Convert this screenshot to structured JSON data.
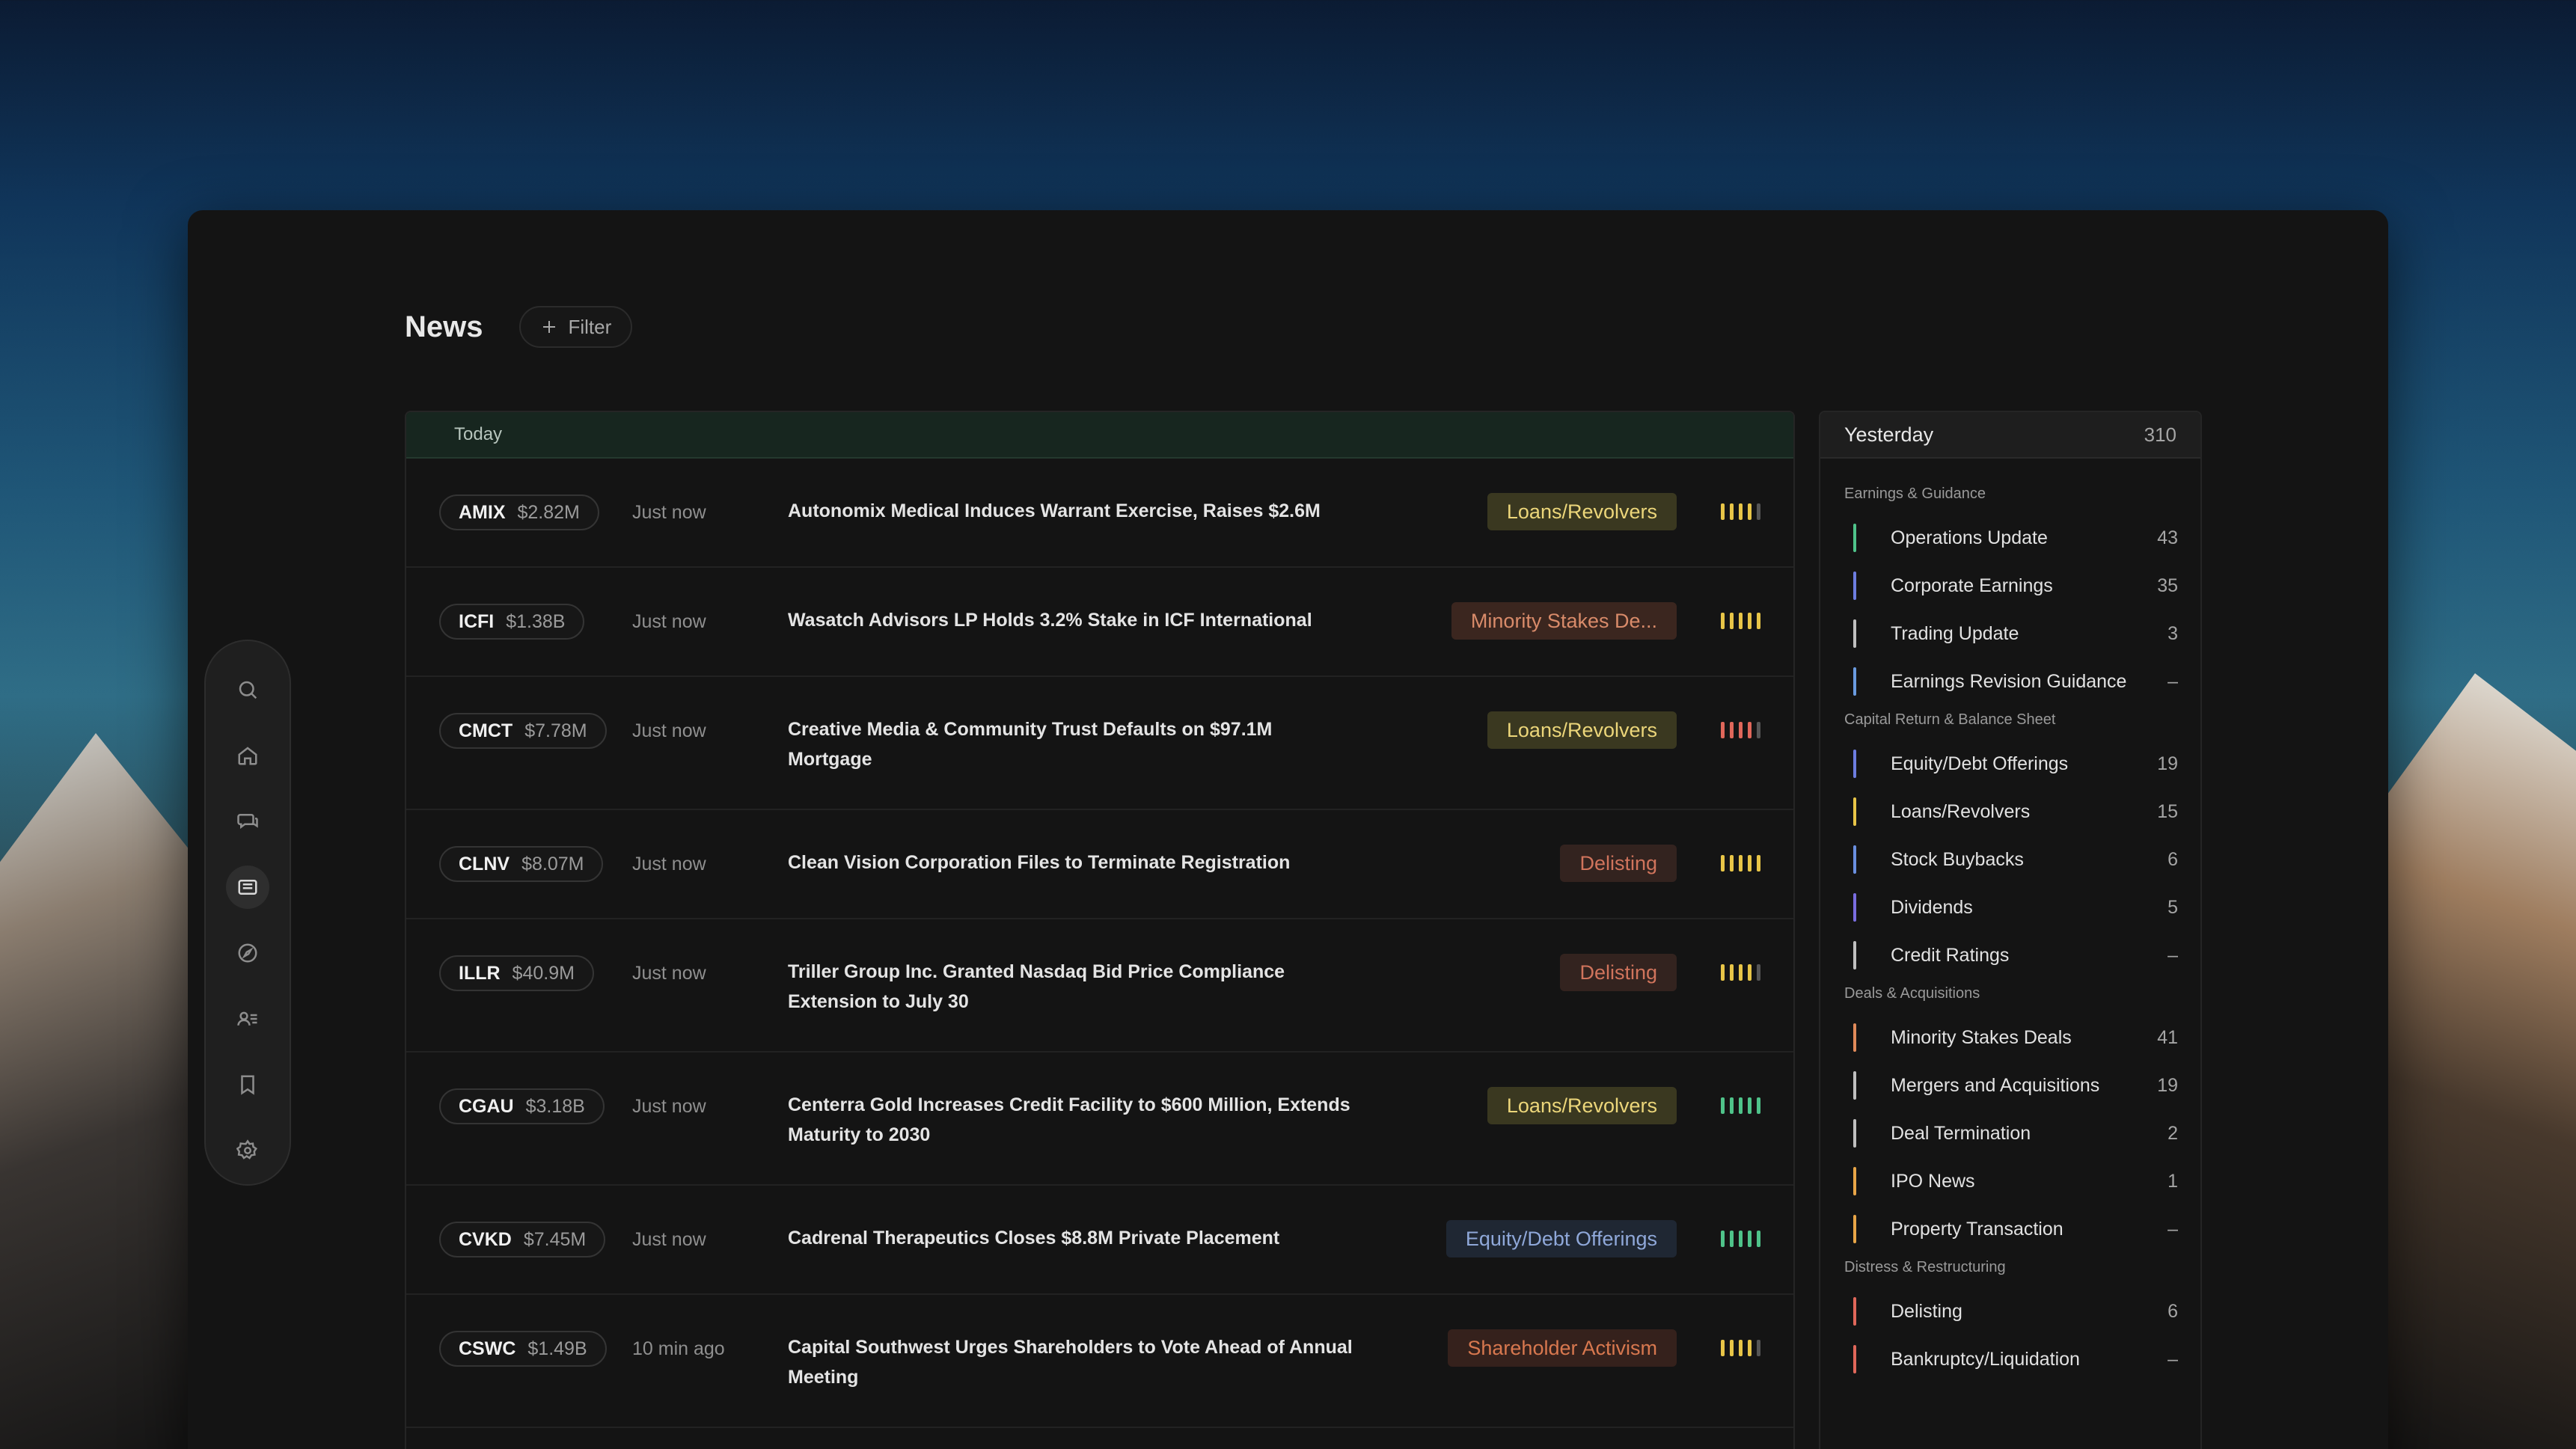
{
  "header": {
    "title": "News",
    "filter_label": "Filter"
  },
  "news_panel": {
    "group_label": "Today",
    "rows": [
      {
        "ticker": "AMIX",
        "mcap": "$2.82M",
        "time": "Just now",
        "headline": "Autonomix Medical Induces Warrant Exercise, Raises $2.6M",
        "tag": "Loans/Revolvers"
      },
      {
        "ticker": "ICFI",
        "mcap": "$1.38B",
        "time": "Just now",
        "headline": "Wasatch Advisors LP Holds 3.2% Stake in ICF International",
        "tag": "Minority Stakes De..."
      },
      {
        "ticker": "CMCT",
        "mcap": "$7.78M",
        "time": "Just now",
        "headline": "Creative Media & Community Trust Defaults on $97.1M Mortgage",
        "tag": "Loans/Revolvers"
      },
      {
        "ticker": "CLNV",
        "mcap": "$8.07M",
        "time": "Just now",
        "headline": "Clean Vision Corporation Files to Terminate Registration",
        "tag": "Delisting"
      },
      {
        "ticker": "ILLR",
        "mcap": "$40.9M",
        "time": "Just now",
        "headline": "Triller Group Inc. Granted Nasdaq Bid Price Compliance Extension to July 30",
        "tag": "Delisting"
      },
      {
        "ticker": "CGAU",
        "mcap": "$3.18B",
        "time": "Just now",
        "headline": "Centerra Gold Increases Credit Facility to $600 Million, Extends Maturity to 2030",
        "tag": "Loans/Revolvers"
      },
      {
        "ticker": "CVKD",
        "mcap": "$7.45M",
        "time": "Just now",
        "headline": "Cadrenal Therapeutics Closes $8.8M Private Placement",
        "tag": "Equity/Debt Offerings"
      },
      {
        "ticker": "CSWC",
        "mcap": "$1.49B",
        "time": "10 min ago",
        "headline": "Capital Southwest Urges Shareholders to Vote Ahead of Annual Meeting",
        "tag": "Shareholder Activism"
      }
    ]
  },
  "side_panel": {
    "title": "Yesterday",
    "count": "310",
    "sections": [
      {
        "label": "Earnings & Guidance",
        "items": [
          {
            "label": "Operations Update",
            "count": "43"
          },
          {
            "label": "Corporate Earnings",
            "count": "35"
          },
          {
            "label": "Trading Update",
            "count": "3"
          },
          {
            "label": "Earnings Revision Guidance",
            "count": "–"
          }
        ]
      },
      {
        "label": "Capital Return & Balance Sheet",
        "items": [
          {
            "label": "Equity/Debt Offerings",
            "count": "19"
          },
          {
            "label": "Loans/Revolvers",
            "count": "15"
          },
          {
            "label": "Stock Buybacks",
            "count": "6"
          },
          {
            "label": "Dividends",
            "count": "5"
          },
          {
            "label": "Credit Ratings",
            "count": "–"
          }
        ]
      },
      {
        "label": "Deals & Acquisitions",
        "items": [
          {
            "label": "Minority Stakes Deals",
            "count": "41"
          },
          {
            "label": "Mergers and Acquisitions",
            "count": "19"
          },
          {
            "label": "Deal Termination",
            "count": "2"
          },
          {
            "label": "IPO News",
            "count": "1"
          },
          {
            "label": "Property Transaction",
            "count": "–"
          }
        ]
      },
      {
        "label": "Distress & Restructuring",
        "items": [
          {
            "label": "Delisting",
            "count": "6"
          },
          {
            "label": "Bankruptcy/Liquidation",
            "count": "–"
          }
        ]
      }
    ]
  },
  "sidebar_icons": [
    "search-icon",
    "home-icon",
    "chat-icon",
    "news-icon",
    "compass-icon",
    "contacts-icon",
    "bookmark-icon",
    "settings-icon"
  ],
  "colors": {
    "green_bar": "#4fc38a",
    "yellow_bar": "#e8c547",
    "red_bar": "#e0675a",
    "gray_bar": "#555555"
  }
}
